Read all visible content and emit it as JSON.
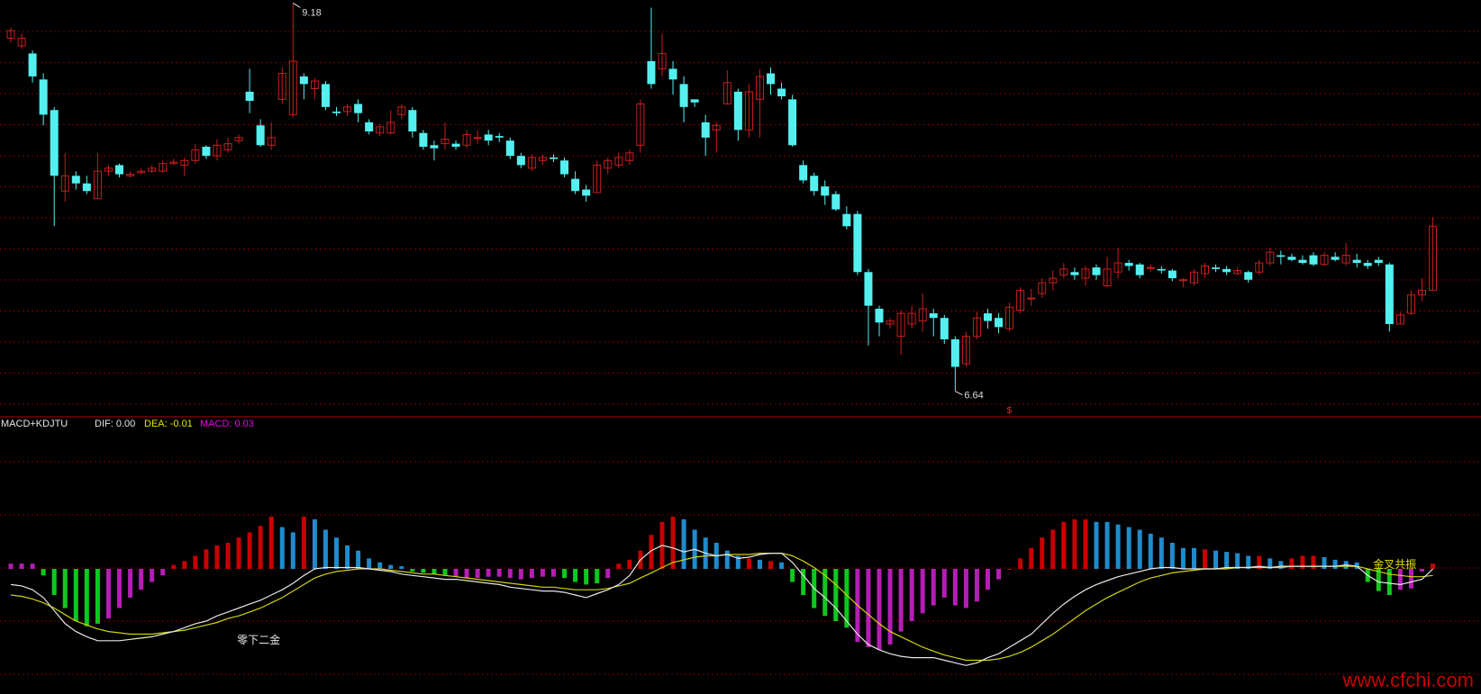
{
  "indicator": {
    "name": "MACD+KDJTU",
    "dif_label": "DIF: 0.00",
    "dea_label": "DEA: -0.01",
    "macd_label": "MACD: 0.03"
  },
  "colors": {
    "background": "#000000",
    "grid": "#7a0000",
    "divider": "#b00000",
    "up": "#c81e1e",
    "down": "#54f0f0",
    "hist_red": "#c80000",
    "hist_blue": "#1e8ccd",
    "hist_green": "#0fc81e",
    "hist_magenta": "#b41eb4",
    "dif": "#e6e6e6",
    "dea": "#d2d20a",
    "dif_label": "#e6e6e6",
    "dea_label": "#e6e600",
    "macd_label": "#e600e6"
  },
  "watermark": "www.cfchi.com",
  "chart_data": [
    {
      "type": "candlestick",
      "title": "",
      "high_label": "9.18",
      "low_label": "6.64",
      "signal_marker": "$",
      "ylim": [
        6.55,
        9.2
      ],
      "candles": [
        [
          8.95,
          9.0,
          8.92,
          9.02
        ],
        [
          8.9,
          8.95,
          8.88,
          8.98
        ],
        [
          8.85,
          8.7,
          8.66,
          8.87
        ],
        [
          8.68,
          8.45,
          8.38,
          8.72
        ],
        [
          8.48,
          8.05,
          7.72,
          8.5
        ],
        [
          7.95,
          8.05,
          7.88,
          8.2
        ],
        [
          8.05,
          8.0,
          7.96,
          8.08
        ],
        [
          8.0,
          7.95,
          7.93,
          8.05
        ],
        [
          7.9,
          8.08,
          7.9,
          8.2
        ],
        [
          8.08,
          8.1,
          8.05,
          8.12
        ],
        [
          8.12,
          8.06,
          8.04,
          8.13
        ],
        [
          8.05,
          8.06,
          8.04,
          8.08
        ],
        [
          8.07,
          8.08,
          8.06,
          8.1
        ],
        [
          8.08,
          8.1,
          8.07,
          8.12
        ],
        [
          8.08,
          8.13,
          8.07,
          8.15
        ],
        [
          8.13,
          8.14,
          8.12,
          8.16
        ],
        [
          8.12,
          8.15,
          8.05,
          8.17
        ],
        [
          8.15,
          8.22,
          8.13,
          8.26
        ],
        [
          8.24,
          8.18,
          8.16,
          8.25
        ],
        [
          8.18,
          8.25,
          8.15,
          8.29
        ],
        [
          8.22,
          8.26,
          8.2,
          8.3
        ],
        [
          8.28,
          8.3,
          8.26,
          8.32
        ],
        [
          8.6,
          8.54,
          8.46,
          8.75
        ],
        [
          8.38,
          8.25,
          8.24,
          8.42
        ],
        [
          8.25,
          8.3,
          8.22,
          8.4
        ],
        [
          8.55,
          8.72,
          8.52,
          8.76
        ],
        [
          8.45,
          8.8,
          8.43,
          9.18
        ],
        [
          8.7,
          8.65,
          8.55,
          8.72
        ],
        [
          8.62,
          8.67,
          8.55,
          8.69
        ],
        [
          8.65,
          8.5,
          8.48,
          8.67
        ],
        [
          8.47,
          8.46,
          8.44,
          8.5
        ],
        [
          8.47,
          8.5,
          8.44,
          8.52
        ],
        [
          8.52,
          8.46,
          8.4,
          8.55
        ],
        [
          8.4,
          8.34,
          8.32,
          8.42
        ],
        [
          8.33,
          8.37,
          8.31,
          8.39
        ],
        [
          8.33,
          8.4,
          8.32,
          8.48
        ],
        [
          8.45,
          8.5,
          8.42,
          8.52
        ],
        [
          8.48,
          8.34,
          8.3,
          8.5
        ],
        [
          8.33,
          8.24,
          8.22,
          8.35
        ],
        [
          8.25,
          8.23,
          8.15,
          8.28
        ],
        [
          8.26,
          8.29,
          8.22,
          8.4
        ],
        [
          8.26,
          8.24,
          8.22,
          8.28
        ],
        [
          8.25,
          8.32,
          8.23,
          8.35
        ],
        [
          8.3,
          8.3,
          8.26,
          8.35
        ],
        [
          8.32,
          8.28,
          8.25,
          8.35
        ],
        [
          8.31,
          8.3,
          8.27,
          8.33
        ],
        [
          8.28,
          8.18,
          8.16,
          8.3
        ],
        [
          8.18,
          8.12,
          8.1,
          8.2
        ],
        [
          8.1,
          8.17,
          8.08,
          8.19
        ],
        [
          8.15,
          8.17,
          8.12,
          8.19
        ],
        [
          8.17,
          8.16,
          8.14,
          8.19
        ],
        [
          8.15,
          8.06,
          8.04,
          8.17
        ],
        [
          8.03,
          7.95,
          7.93,
          8.08
        ],
        [
          7.96,
          7.92,
          7.88,
          7.99
        ],
        [
          7.94,
          8.12,
          7.94,
          8.15
        ],
        [
          8.1,
          8.15,
          8.06,
          8.17
        ],
        [
          8.12,
          8.17,
          8.1,
          8.2
        ],
        [
          8.15,
          8.2,
          8.12,
          8.22
        ],
        [
          8.25,
          8.52,
          8.2,
          8.55
        ],
        [
          8.8,
          8.65,
          8.62,
          9.15
        ],
        [
          8.75,
          8.85,
          8.7,
          8.98
        ],
        [
          8.75,
          8.68,
          8.58,
          8.8
        ],
        [
          8.65,
          8.5,
          8.4,
          8.7
        ],
        [
          8.55,
          8.53,
          8.5,
          8.55
        ],
        [
          8.4,
          8.3,
          8.18,
          8.45
        ],
        [
          8.35,
          8.38,
          8.2,
          8.4
        ],
        [
          8.52,
          8.66,
          8.52,
          8.74
        ],
        [
          8.6,
          8.35,
          8.28,
          8.62
        ],
        [
          8.35,
          8.6,
          8.3,
          8.65
        ],
        [
          8.55,
          8.7,
          8.3,
          8.75
        ],
        [
          8.72,
          8.65,
          8.58,
          8.76
        ],
        [
          8.62,
          8.57,
          8.55,
          8.66
        ],
        [
          8.55,
          8.25,
          8.24,
          8.58
        ],
        [
          8.12,
          8.02,
          8.0,
          8.15
        ],
        [
          8.05,
          7.95,
          7.92,
          8.07
        ],
        [
          7.98,
          7.92,
          7.86,
          8.02
        ],
        [
          7.93,
          7.83,
          7.82,
          7.95
        ],
        [
          7.8,
          7.72,
          7.7,
          7.85
        ],
        [
          7.8,
          7.42,
          7.4,
          7.82
        ],
        [
          7.42,
          7.2,
          6.94,
          7.44
        ],
        [
          7.18,
          7.09,
          7.0,
          7.2
        ],
        [
          7.08,
          7.1,
          7.05,
          7.12
        ],
        [
          7.0,
          7.15,
          6.88,
          7.17
        ],
        [
          7.08,
          7.15,
          7.05,
          7.2
        ],
        [
          7.1,
          7.18,
          7.03,
          7.28
        ],
        [
          7.15,
          7.12,
          7.0,
          7.18
        ],
        [
          7.12,
          6.98,
          6.95,
          7.14
        ],
        [
          6.98,
          6.8,
          6.64,
          7.0
        ],
        [
          6.82,
          7.0,
          6.8,
          7.03
        ],
        [
          7.0,
          7.12,
          6.98,
          7.16
        ],
        [
          7.15,
          7.1,
          7.05,
          7.18
        ],
        [
          7.12,
          7.06,
          7.02,
          7.15
        ],
        [
          7.05,
          7.19,
          7.03,
          7.22
        ],
        [
          7.17,
          7.3,
          7.15,
          7.32
        ],
        [
          7.25,
          7.25,
          7.2,
          7.31
        ],
        [
          7.28,
          7.35,
          7.25,
          7.38
        ],
        [
          7.35,
          7.38,
          7.3,
          7.43
        ],
        [
          7.4,
          7.44,
          7.38,
          7.48
        ],
        [
          7.42,
          7.4,
          7.37,
          7.45
        ],
        [
          7.38,
          7.44,
          7.33,
          7.46
        ],
        [
          7.45,
          7.4,
          7.37,
          7.47
        ],
        [
          7.33,
          7.44,
          7.32,
          7.52
        ],
        [
          7.42,
          7.48,
          7.38,
          7.58
        ],
        [
          7.48,
          7.46,
          7.43,
          7.5
        ],
        [
          7.47,
          7.4,
          7.38,
          7.48
        ],
        [
          7.45,
          7.45,
          7.42,
          7.47
        ],
        [
          7.44,
          7.43,
          7.41,
          7.46
        ],
        [
          7.43,
          7.38,
          7.36,
          7.44
        ],
        [
          7.37,
          7.37,
          7.32,
          7.38
        ],
        [
          7.35,
          7.42,
          7.33,
          7.44
        ],
        [
          7.41,
          7.46,
          7.38,
          7.48
        ],
        [
          7.45,
          7.44,
          7.42,
          7.47
        ],
        [
          7.44,
          7.42,
          7.4,
          7.46
        ],
        [
          7.41,
          7.43,
          7.4,
          7.45
        ],
        [
          7.42,
          7.37,
          7.35,
          7.43
        ],
        [
          7.42,
          7.48,
          7.4,
          7.5
        ],
        [
          7.48,
          7.55,
          7.46,
          7.58
        ],
        [
          7.53,
          7.52,
          7.47,
          7.56
        ],
        [
          7.52,
          7.5,
          7.49,
          7.54
        ],
        [
          7.5,
          7.48,
          7.47,
          7.53
        ],
        [
          7.53,
          7.47,
          7.46,
          7.55
        ],
        [
          7.47,
          7.53,
          7.46,
          7.55
        ],
        [
          7.52,
          7.5,
          7.49,
          7.55
        ],
        [
          7.48,
          7.53,
          7.46,
          7.61
        ],
        [
          7.5,
          7.48,
          7.45,
          7.54
        ],
        [
          7.48,
          7.46,
          7.44,
          7.5
        ],
        [
          7.5,
          7.48,
          7.46,
          7.52
        ],
        [
          7.47,
          7.08,
          7.03,
          7.48
        ],
        [
          7.08,
          7.14,
          7.08,
          7.16
        ],
        [
          7.15,
          7.27,
          7.14,
          7.3
        ],
        [
          7.27,
          7.3,
          7.23,
          7.38
        ],
        [
          7.3,
          7.72,
          7.3,
          7.78
        ]
      ]
    },
    {
      "type": "macd",
      "ylim": [
        -0.5,
        0.42
      ],
      "histogram": [
        0.04,
        0.04,
        0.04,
        -0.05,
        -0.2,
        -0.3,
        -0.4,
        -0.44,
        -0.42,
        -0.38,
        -0.3,
        -0.22,
        -0.16,
        -0.1,
        -0.05,
        0.03,
        0.06,
        0.1,
        0.15,
        0.18,
        0.2,
        0.24,
        0.28,
        0.33,
        0.4,
        0.32,
        0.28,
        0.4,
        0.38,
        0.3,
        0.24,
        0.18,
        0.14,
        0.08,
        0.05,
        0.03,
        0.02,
        -0.02,
        -0.03,
        -0.04,
        -0.05,
        -0.06,
        -0.07,
        -0.07,
        -0.06,
        -0.06,
        -0.07,
        -0.08,
        -0.07,
        -0.06,
        -0.06,
        -0.07,
        -0.1,
        -0.12,
        -0.11,
        -0.07,
        0.04,
        0.07,
        0.14,
        0.26,
        0.36,
        0.4,
        0.38,
        0.3,
        0.24,
        0.2,
        0.14,
        0.1,
        0.08,
        0.07,
        0.06,
        0.05,
        -0.1,
        -0.2,
        -0.3,
        -0.36,
        -0.4,
        -0.45,
        -0.56,
        -0.6,
        -0.62,
        -0.58,
        -0.48,
        -0.4,
        -0.34,
        -0.28,
        -0.22,
        -0.28,
        -0.3,
        -0.25,
        -0.16,
        -0.08,
        0.0,
        0.08,
        0.16,
        0.24,
        0.3,
        0.36,
        0.38,
        0.38,
        0.36,
        0.36,
        0.34,
        0.32,
        0.3,
        0.27,
        0.24,
        0.2,
        0.16,
        0.16,
        0.15,
        0.14,
        0.13,
        0.12,
        0.1,
        0.1,
        0.08,
        0.06,
        0.08,
        0.1,
        0.1,
        0.09,
        0.07,
        0.06,
        0.05,
        -0.1,
        -0.17,
        -0.2,
        -0.16,
        -0.15,
        -0.02,
        0.04
      ],
      "hist_colors": [
        "m",
        "m",
        "m",
        "g",
        "g",
        "g",
        "g",
        "g",
        "g",
        "m",
        "m",
        "m",
        "m",
        "m",
        "m",
        "r",
        "r",
        "r",
        "r",
        "r",
        "r",
        "r",
        "r",
        "r",
        "r",
        "b",
        "b",
        "r",
        "b",
        "b",
        "b",
        "b",
        "b",
        "b",
        "b",
        "b",
        "b",
        "g",
        "g",
        "g",
        "g",
        "m",
        "m",
        "m",
        "m",
        "m",
        "m",
        "m",
        "m",
        "m",
        "m",
        "g",
        "g",
        "g",
        "g",
        "m",
        "r",
        "r",
        "r",
        "r",
        "r",
        "r",
        "b",
        "b",
        "b",
        "b",
        "b",
        "b",
        "r",
        "b",
        "r",
        "b",
        "g",
        "g",
        "g",
        "g",
        "g",
        "g",
        "m",
        "m",
        "m",
        "m",
        "m",
        "m",
        "m",
        "m",
        "m",
        "m",
        "m",
        "m",
        "m",
        "m",
        "r",
        "r",
        "r",
        "r",
        "r",
        "r",
        "r",
        "r",
        "b",
        "b",
        "b",
        "b",
        "b",
        "b",
        "b",
        "b",
        "b",
        "b",
        "r",
        "b",
        "b",
        "b",
        "b",
        "r",
        "b",
        "b",
        "r",
        "r",
        "r",
        "b",
        "b",
        "b",
        "b",
        "g",
        "g",
        "g",
        "m",
        "m",
        "m",
        "r"
      ],
      "dif": [
        -0.12,
        -0.13,
        -0.16,
        -0.22,
        -0.32,
        -0.42,
        -0.48,
        -0.52,
        -0.55,
        -0.55,
        -0.55,
        -0.54,
        -0.53,
        -0.52,
        -0.5,
        -0.48,
        -0.45,
        -0.42,
        -0.4,
        -0.36,
        -0.33,
        -0.3,
        -0.27,
        -0.24,
        -0.2,
        -0.16,
        -0.11,
        -0.05,
        0.0,
        0.01,
        0.01,
        0.01,
        0.01,
        0.0,
        -0.01,
        -0.02,
        -0.04,
        -0.05,
        -0.06,
        -0.07,
        -0.08,
        -0.08,
        -0.09,
        -0.1,
        -0.11,
        -0.12,
        -0.14,
        -0.15,
        -0.16,
        -0.17,
        -0.17,
        -0.18,
        -0.2,
        -0.22,
        -0.19,
        -0.16,
        -0.12,
        -0.05,
        0.07,
        0.14,
        0.18,
        0.16,
        0.13,
        0.15,
        0.12,
        0.1,
        0.11,
        0.08,
        0.09,
        0.11,
        0.12,
        0.12,
        0.05,
        -0.05,
        -0.15,
        -0.22,
        -0.3,
        -0.4,
        -0.5,
        -0.58,
        -0.62,
        -0.65,
        -0.67,
        -0.68,
        -0.68,
        -0.68,
        -0.7,
        -0.72,
        -0.74,
        -0.72,
        -0.68,
        -0.65,
        -0.6,
        -0.55,
        -0.5,
        -0.42,
        -0.34,
        -0.27,
        -0.21,
        -0.16,
        -0.12,
        -0.09,
        -0.06,
        -0.04,
        -0.02,
        0.0,
        0.01,
        0.01,
        0.0,
        0.0,
        0.0,
        0.0,
        0.01,
        0.01,
        0.01,
        0.02,
        0.01,
        0.02,
        0.02,
        0.02,
        0.02,
        0.02,
        0.02,
        0.03,
        0.02,
        -0.05,
        -0.1,
        -0.11,
        -0.12,
        -0.1,
        -0.08,
        0.0
      ],
      "dea": [
        -0.2,
        -0.21,
        -0.23,
        -0.26,
        -0.3,
        -0.35,
        -0.4,
        -0.43,
        -0.46,
        -0.48,
        -0.49,
        -0.5,
        -0.5,
        -0.5,
        -0.49,
        -0.48,
        -0.47,
        -0.45,
        -0.43,
        -0.41,
        -0.38,
        -0.36,
        -0.33,
        -0.3,
        -0.26,
        -0.22,
        -0.17,
        -0.12,
        -0.07,
        -0.04,
        -0.02,
        -0.01,
        0.0,
        0.0,
        0.0,
        -0.01,
        -0.02,
        -0.03,
        -0.04,
        -0.04,
        -0.05,
        -0.06,
        -0.07,
        -0.08,
        -0.09,
        -0.1,
        -0.11,
        -0.12,
        -0.13,
        -0.14,
        -0.14,
        -0.15,
        -0.16,
        -0.16,
        -0.16,
        -0.15,
        -0.13,
        -0.11,
        -0.07,
        -0.03,
        0.01,
        0.05,
        0.07,
        0.09,
        0.1,
        0.1,
        0.11,
        0.11,
        0.11,
        0.12,
        0.12,
        0.12,
        0.1,
        0.06,
        0.01,
        -0.05,
        -0.12,
        -0.2,
        -0.28,
        -0.35,
        -0.42,
        -0.48,
        -0.52,
        -0.56,
        -0.6,
        -0.63,
        -0.66,
        -0.68,
        -0.7,
        -0.7,
        -0.7,
        -0.69,
        -0.67,
        -0.64,
        -0.6,
        -0.55,
        -0.5,
        -0.44,
        -0.38,
        -0.32,
        -0.27,
        -0.22,
        -0.18,
        -0.14,
        -0.1,
        -0.07,
        -0.05,
        -0.03,
        -0.02,
        -0.01,
        0.0,
        0.0,
        0.0,
        0.01,
        0.01,
        0.01,
        0.01,
        0.01,
        0.02,
        0.02,
        0.02,
        0.02,
        0.02,
        0.02,
        0.02,
        0.0,
        -0.02,
        -0.04,
        -0.05,
        -0.06,
        -0.06,
        -0.05
      ],
      "annotations": [
        {
          "text": "零下二金",
          "index": 22,
          "value": -0.56
        },
        {
          "text": "金叉共振",
          "index": 125,
          "value": -0.02
        }
      ]
    }
  ]
}
